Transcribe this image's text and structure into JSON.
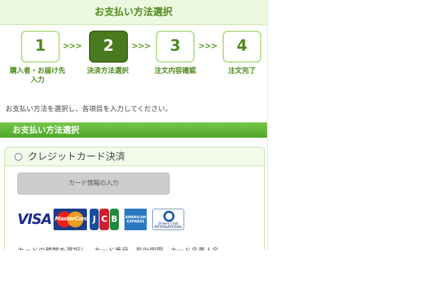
{
  "header": {
    "title": "お支払い方法選択"
  },
  "steps": [
    {
      "number": "1",
      "label_line1": "購入者・お届け先",
      "label_line2": "入力",
      "active": false
    },
    {
      "number": "2",
      "label_line1": "決済方法選択",
      "label_line2": "",
      "active": true
    },
    {
      "number": "3",
      "label_line1": "注文内容確認",
      "label_line2": "",
      "active": false
    },
    {
      "number": "4",
      "label_line1": "注文完了",
      "label_line2": "",
      "active": false
    }
  ],
  "step_arrow": ">>>",
  "instruction": "お支払い方法を選択し、各項目を入力してください。",
  "section": {
    "title": "お支払い方法選択"
  },
  "payment_methods": [
    {
      "label": "クレジットカード決済",
      "selected": false,
      "button_label": "カード情報の入力",
      "card_brands": {
        "visa": "VISA",
        "mastercard": "MasterCard",
        "jcb": [
          "J",
          "C",
          "B"
        ],
        "amex": [
          "AMERICAN",
          "EXPRESS"
        ],
        "diners": [
          "Diners Club",
          "INTERNATIONAL"
        ]
      },
      "note": "カードの種類を選択し、カード番号、有効期限、カード名義人名"
    }
  ],
  "colors": {
    "brand_green": "#4e8a1a",
    "active_step": "#4a7a1f",
    "section_bar": "#5fb536",
    "header_bg": "#ecf8df"
  }
}
